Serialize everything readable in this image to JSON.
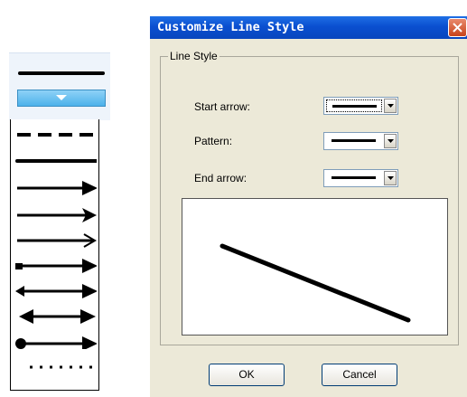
{
  "picker": {
    "current_style": "solid-line",
    "options": [
      {
        "id": "dashed"
      },
      {
        "id": "solid"
      },
      {
        "id": "arrow-filled"
      },
      {
        "id": "arrow-open"
      },
      {
        "id": "arrow-thin"
      },
      {
        "id": "arrow-square-start"
      },
      {
        "id": "arrow-tail-arrow"
      },
      {
        "id": "double-arrow"
      },
      {
        "id": "arrow-dot-start"
      },
      {
        "id": "dotted"
      }
    ]
  },
  "dialog": {
    "title": "Customize Line Style",
    "group_label": "Line Style",
    "fields": {
      "start_arrow": {
        "label": "Start arrow:",
        "value": "none"
      },
      "pattern": {
        "label": "Pattern:",
        "value": "solid"
      },
      "end_arrow": {
        "label": "End arrow:",
        "value": "none"
      }
    },
    "ok_label": "OK",
    "cancel_label": "Cancel"
  }
}
